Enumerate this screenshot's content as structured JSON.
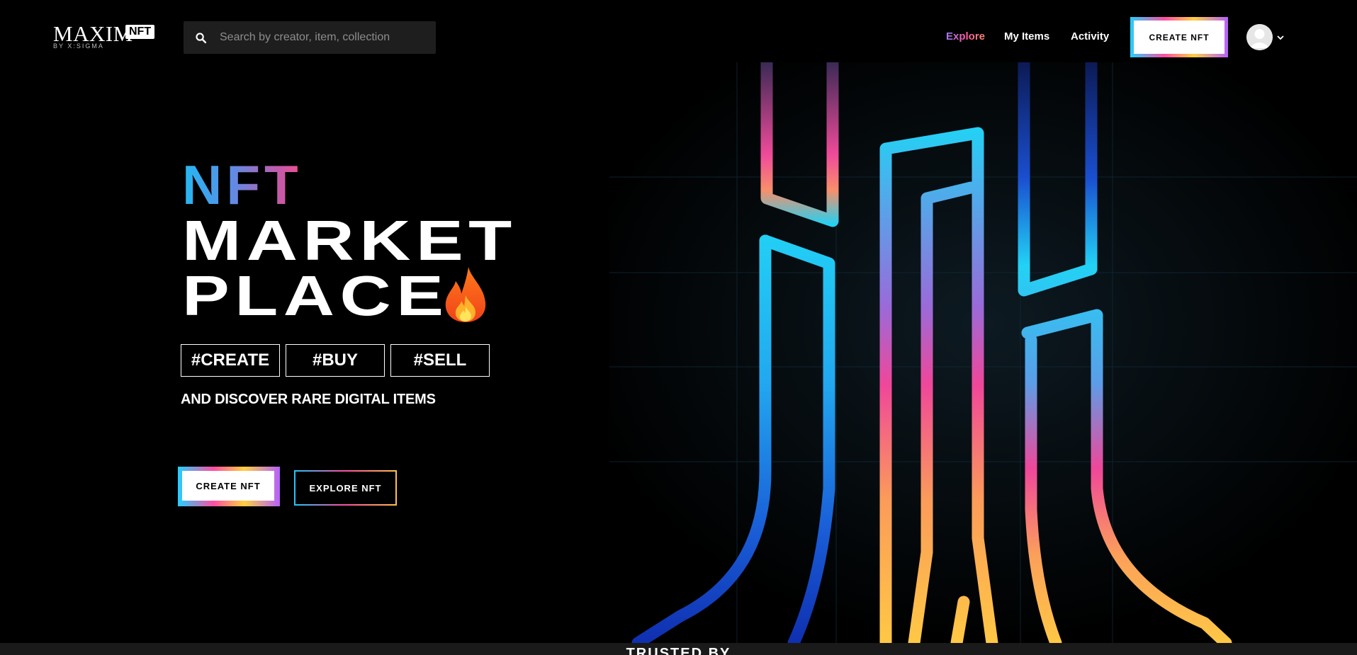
{
  "header": {
    "logo": {
      "word": "MAXIM",
      "badge": "NFT",
      "sub": "BY X:SIGMA"
    },
    "search": {
      "placeholder": "Search by creator, item, collection",
      "value": ""
    },
    "nav": [
      {
        "label": "Explore",
        "active": true
      },
      {
        "label": "My Items",
        "active": false
      },
      {
        "label": "Activity",
        "active": false
      }
    ],
    "create_button": "CREATE NFT",
    "icons": {
      "search": "search-icon",
      "avatar": "user-avatar",
      "chevron": "chevron-down-icon"
    }
  },
  "hero": {
    "title_line1": "NFT",
    "title_line2": "MARKET",
    "title_line3": "PLACE",
    "title_emoji": "fire-emoji",
    "tags": [
      "#CREATE",
      "#BUY",
      "#SELL"
    ],
    "subtitle": "AND DISCOVER RARE DIGITAL ITEMS",
    "primary_button": "CREATE NFT",
    "secondary_button": "EXPLORE NFT"
  },
  "trusted": {
    "label": "TRUSTED BY"
  },
  "colors": {
    "background": "#000000",
    "accent_cyan": "#22c8f5",
    "accent_pink": "#f0479a",
    "accent_yellow": "#ffc845",
    "accent_blue": "#1a4fd0",
    "search_bg": "#1e1e1e"
  }
}
